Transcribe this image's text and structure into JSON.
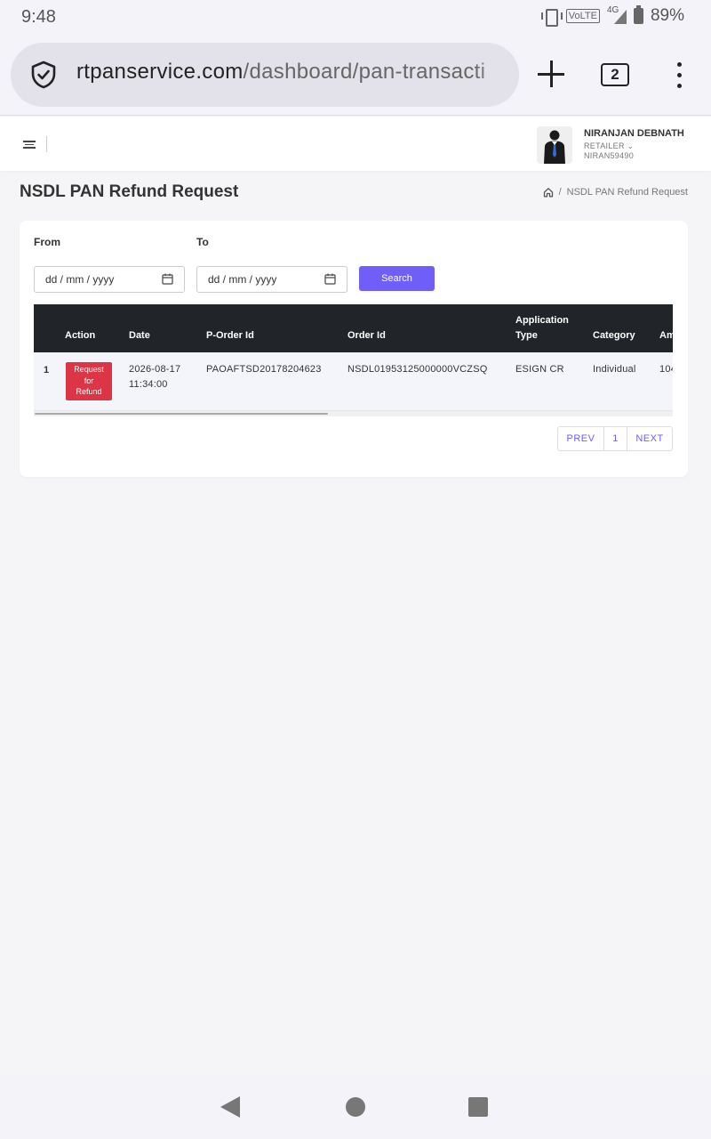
{
  "status": {
    "time": "9:48",
    "volte": "VoLTE",
    "network": "4G",
    "battery": "89%"
  },
  "browser": {
    "url_host": "rtpanservice.com",
    "url_path": "/dashboard/pan-transacti",
    "tab_count": "2"
  },
  "header": {
    "user_name": "NIRANJAN DEBNATH",
    "user_role": "RETAILER ⌄",
    "user_id": "NIRAN59490"
  },
  "page": {
    "title": "NSDL PAN Refund Request",
    "breadcrumb_current": "NSDL PAN Refund Request",
    "breadcrumb_sep": "/"
  },
  "filters": {
    "from_label": "From",
    "to_label": "To",
    "from_placeholder": "dd / mm / yyyy",
    "to_placeholder": "dd / mm / yyyy",
    "search_label": "Search"
  },
  "table": {
    "headers": {
      "action": "Action",
      "date": "Date",
      "porder": "P-Order Id",
      "order": "Order Id",
      "apptype_1": "Application",
      "apptype_2": "Type",
      "category": "Category",
      "amount": "Am"
    },
    "rows": [
      {
        "index": "1",
        "action_1": "Request",
        "action_2": "for",
        "action_3": "Refund",
        "date_1": "2026-08-17",
        "date_2": "11:34:00",
        "porder": "PAOAFTSD20178204623",
        "order": "NSDL01953125000000VCZSQ",
        "apptype": "ESIGN CR",
        "category": "Individual",
        "amount": "104"
      }
    ]
  },
  "pagination": {
    "prev": "PREV",
    "page": "1",
    "next": "NEXT"
  },
  "colors": {
    "accent": "#6f5ef7",
    "danger": "#dc3545",
    "table_header": "#212529"
  }
}
